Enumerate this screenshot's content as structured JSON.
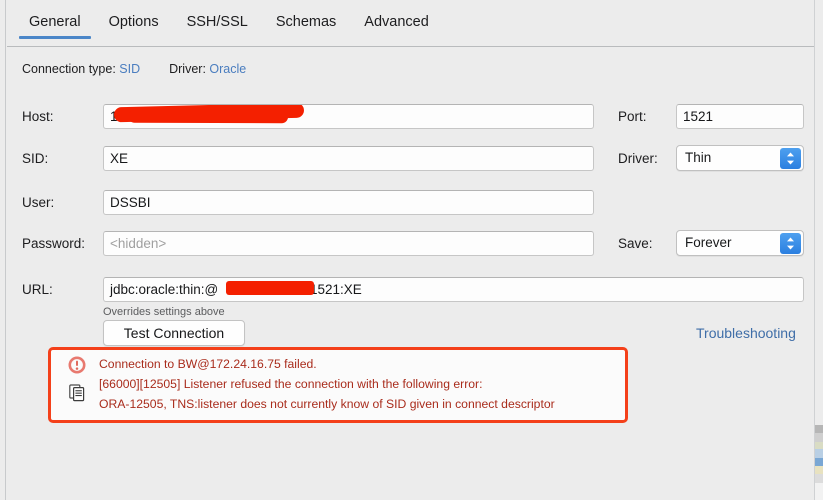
{
  "tabs": [
    {
      "label": "General",
      "active": true
    },
    {
      "label": "Options",
      "active": false
    },
    {
      "label": "SSH/SSL",
      "active": false
    },
    {
      "label": "Schemas",
      "active": false
    },
    {
      "label": "Advanced",
      "active": false
    }
  ],
  "connection_info": {
    "type_label": "Connection type:",
    "type_value": "SID",
    "driver_label": "Driver:",
    "driver_value": "Oracle"
  },
  "form": {
    "host": {
      "label": "Host:",
      "value": "172.2",
      "redacted": true
    },
    "port": {
      "label": "Port:",
      "value": "1521"
    },
    "sid": {
      "label": "SID:",
      "value": "XE"
    },
    "driver": {
      "label": "Driver:",
      "value": "Thin"
    },
    "user": {
      "label": "User:",
      "value": "DSSBI"
    },
    "save": {
      "label": "Save:",
      "value": "Forever"
    },
    "password": {
      "label": "Password:",
      "value": "<hidden>",
      "is_placeholder": true
    },
    "url": {
      "label": "URL:",
      "prefix": "jdbc:oracle:thin:@",
      "suffix": ":1521:XE",
      "hint": "Overrides settings above"
    }
  },
  "actions": {
    "test_connection": "Test Connection",
    "troubleshooting": "Troubleshooting"
  },
  "error": {
    "icon": "error-circle-icon",
    "copy_icon": "copy-icon",
    "lines": [
      "Connection to BW@172.24.16.75 failed.",
      "[66000][12505] Listener refused the connection with the following error:",
      "ORA-12505, TNS:listener does not currently know of SID given in connect descriptor"
    ]
  },
  "colors": {
    "background": "#ececec",
    "accent_blue": "#4b86c8",
    "link_blue": "#4a7dbf",
    "error_border": "#f4401a",
    "error_text": "#a92c1c",
    "redaction_red": "#f42000",
    "stepper_blue": "#2b7fe0"
  }
}
